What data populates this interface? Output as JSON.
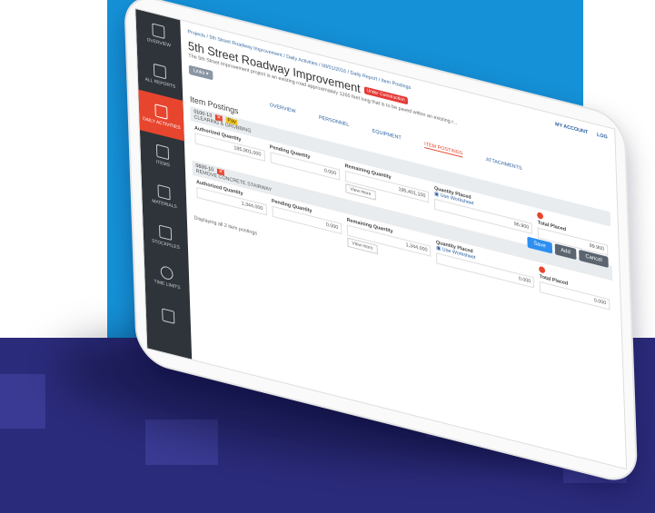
{
  "nav": {
    "items": [
      {
        "label": "Overview",
        "icon": "overview-icon",
        "active": false
      },
      {
        "label": "All Reports",
        "icon": "reports-icon",
        "active": false
      },
      {
        "label": "Daily Activities",
        "icon": "calendar-icon",
        "active": true
      },
      {
        "label": "Items",
        "icon": "items-icon",
        "active": false
      },
      {
        "label": "Materials",
        "icon": "materials-icon",
        "active": false
      },
      {
        "label": "Stockpiles",
        "icon": "stockpiles-icon",
        "active": false
      },
      {
        "label": "Time Limits",
        "icon": "clock-icon",
        "active": false
      },
      {
        "label": "",
        "icon": "gavel-icon",
        "active": false
      }
    ]
  },
  "breadcrumb": "Projects / 5th Street Roadway Improvement / Daily Activities / 08/01/2016 / Daily Report / Item Postings",
  "account": {
    "my_account": "My Account",
    "logout": "Log"
  },
  "project": {
    "title": "5th Street Roadway Improvement",
    "status": "Under Construction",
    "description": "The 5th Street Improvement project is an existing road approximately 1260 feet long that is to be paved within an existing r...",
    "links_label": "Links"
  },
  "tabs": [
    "Overview",
    "Personnel",
    "Equipment",
    "Item Postings",
    "Attachments"
  ],
  "active_tab": "Item Postings",
  "section_title": "Item Postings",
  "buttons": {
    "save": "Save",
    "add": "Add",
    "cancel": "Cancel"
  },
  "postings": [
    {
      "code": "0100-13",
      "name": "CLEARING & GRUBBING",
      "tag": "Pay",
      "authorized_label": "Authorized Quantity",
      "authorized": "195,901,000",
      "pending_label": "Pending Quantity",
      "pending": "0.000",
      "remaining_label": "Remaining Quantity",
      "remaining": "195,401,100",
      "placed_label": "Quantity Placed",
      "worksheet": "Use Worksheet",
      "placed": "96.900",
      "total_label": "Total Placed",
      "total": "99.900",
      "view_more": "View more"
    },
    {
      "code": "0600-10",
      "name": "REMOVE CONCRETE STAIRWAY",
      "tag": "",
      "authorized_label": "Authorized Quantity",
      "authorized": "1,344.000",
      "pending_label": "Pending Quantity",
      "pending": "0.000",
      "remaining_label": "Remaining Quantity",
      "remaining": "1,344.000",
      "placed_label": "Quantity Placed",
      "worksheet": "Use Worksheet",
      "placed": "0.000",
      "total_label": "Total Placed",
      "total": "0.000",
      "view_more": "View more"
    }
  ],
  "footer": "Displaying all 2 item postings",
  "colors": {
    "blue_bg": "#1591d8",
    "navy_bg": "#2b2b7c",
    "accent": "#e8452e",
    "sidebar": "#2e3439"
  }
}
